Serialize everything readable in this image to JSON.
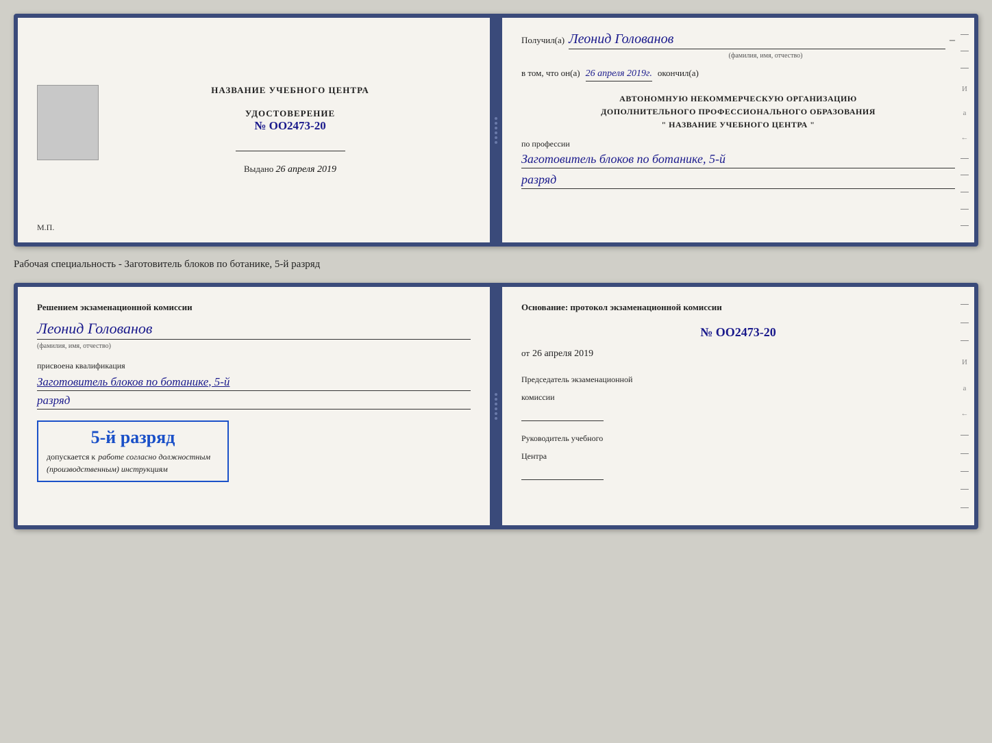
{
  "top_doc": {
    "left": {
      "title": "НАЗВАНИЕ УЧЕБНОГО ЦЕНТРА",
      "udost_label": "УДОСТОВЕРЕНИЕ",
      "udost_number": "№ OO2473-20",
      "vydano_prefix": "Выдано",
      "vydano_date": "26 апреля 2019",
      "mp_label": "М.П."
    },
    "right": {
      "poluchil_prefix": "Получил(a)",
      "recipient_name": "Леонид Голованов",
      "fio_subtitle": "(фамилия, имя, отчество)",
      "vtom_prefix": "в том, что он(а)",
      "vtom_date": "26 апреля 2019г.",
      "okonchil": "окончил(a)",
      "auto_org_line1": "АВТОНОМНУЮ НЕКОММЕРЧЕСКУЮ ОРГАНИЗАЦИЮ",
      "auto_org_line2": "ДОПОЛНИТЕЛЬНОГО ПРОФЕССИОНАЛЬНОГО ОБРАЗОВАНИЯ",
      "auto_org_line3": "\"   НАЗВАНИЕ УЧЕБНОГО ЦЕНТРА   \"",
      "po_professii": "по профессии",
      "profession": "Заготовитель блоков по ботанике, 5-й",
      "razryad": "разряд",
      "dash": "–"
    }
  },
  "specialty_label": "Рабочая специальность - Заготовитель блоков по ботанике, 5-й разряд",
  "bottom_doc": {
    "left": {
      "resheniem_text": "Решением  экзаменационной  комиссии",
      "person_name": "Леонид Голованов",
      "fio_subtitle": "(фамилия, имя, отчество)",
      "prisvoena": "присвоена квалификация",
      "qualification": "Заготовитель блоков по ботанике, 5-й",
      "razryad": "разряд",
      "stamp_rank": "5-й разряд",
      "dopusk_prefix": "допускается к",
      "dopusk_italic": "работе согласно должностным",
      "dopusk_italic2": "(производственным) инструкциям"
    },
    "right": {
      "osnovanie": "Основание: протокол экзаменационной  комиссии",
      "protocol_number": "№  OO2473-20",
      "ot_prefix": "от",
      "ot_date": "26 апреля 2019",
      "chairman_label1": "Председатель экзаменационной",
      "chairman_label2": "комиссии",
      "rukovoditel_label1": "Руководитель учебного",
      "rukovoditel_label2": "Центра"
    }
  }
}
